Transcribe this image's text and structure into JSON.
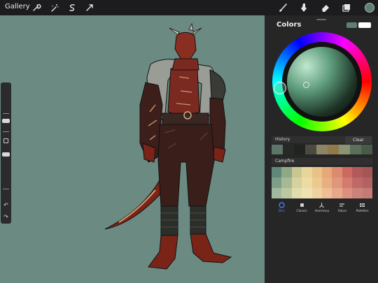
{
  "toolbar": {
    "gallery_label": "Gallery",
    "left_tools": [
      "wrench-icon",
      "magic-wand-icon",
      "selection-icon",
      "move-arrow-icon"
    ],
    "right_tools": [
      "brush-icon",
      "smudge-icon",
      "eraser-icon",
      "layers-icon",
      "color-icon"
    ],
    "current_color": "#5f7f6f"
  },
  "canvas": {
    "background": "#6b8a82"
  },
  "colors_panel": {
    "title": "Colors",
    "current_color": "#5f7f6f",
    "previous_color": "#ffffff",
    "history": {
      "label": "History",
      "clear_label": "Clear",
      "swatches": [
        "#5d7468",
        "#262a24",
        "#202320",
        "#4a4a3e",
        "#8e8468",
        "#907a4a",
        "#8a9474",
        "#5a7058",
        "#4a5a48"
      ]
    },
    "palette": {
      "label": "Campfire",
      "swatches": [
        "#5f8878",
        "#8fa886",
        "#c9c692",
        "#e8d59a",
        "#e8c286",
        "#e6a878",
        "#dc8a70",
        "#cc6a62",
        "#b25a5a",
        "#a45656",
        "#7d9e8a",
        "#a6b894",
        "#d4d29e",
        "#ecdca4",
        "#ecc98e",
        "#e8b082",
        "#e0967a",
        "#d47a6e",
        "#c06868",
        "#b26262",
        "#a3b89c",
        "#bcc8a2",
        "#e0dcac",
        "#f0e2b0",
        "#f0d2a0",
        "#eebe94",
        "#e8a68a",
        "#dc9080",
        "#cc8278",
        "#c27c74"
      ]
    },
    "tabs": [
      {
        "label": "Disc",
        "icon": "disc-icon"
      },
      {
        "label": "Classic",
        "icon": "classic-icon"
      },
      {
        "label": "Harmony",
        "icon": "harmony-icon"
      },
      {
        "label": "Value",
        "icon": "value-icon"
      },
      {
        "label": "Palettes",
        "icon": "palettes-icon"
      }
    ],
    "active_tab": "Disc"
  }
}
